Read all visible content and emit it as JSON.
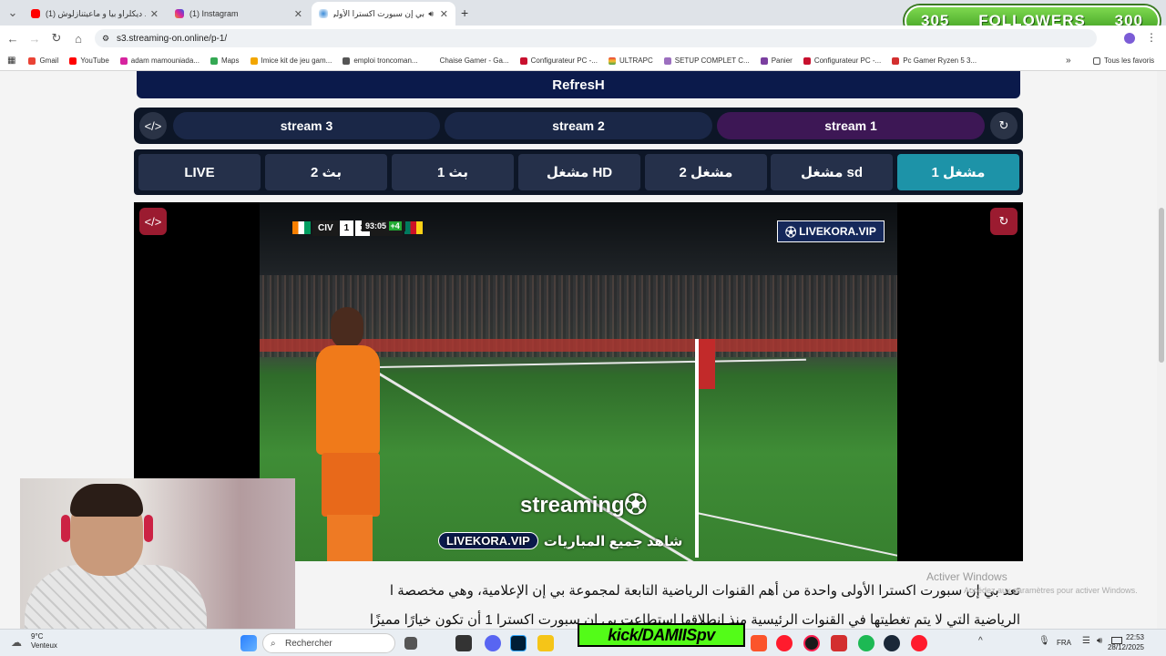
{
  "browser": {
    "tabs": [
      {
        "title": "(1) ديكلراو بيا و ماعيتنازلوش ... -",
        "active": false,
        "icon": "youtube-icon"
      },
      {
        "title": "(1) Instagram",
        "active": false,
        "icon": "instagram-icon"
      },
      {
        "title": "بي إن سبورت اكسترا الأولى",
        "active": true,
        "icon": "site-icon"
      }
    ],
    "url": "s3.streaming-on.online/p-1/",
    "bookmarks": [
      "Gmail",
      "YouTube",
      "adam mamouniada...",
      "Maps",
      "Imice kit de jeu gam...",
      "emploi troncoman...",
      "Chaise Gamer - Ga...",
      "Configurateur PC -...",
      "ULTRAPC",
      "SETUP COMPLET C...",
      "Panier",
      "Configurateur PC -...",
      "Pc Gamer Ryzen 5 3..."
    ],
    "all_bookmarks": "Tous les favoris",
    "colors": {
      "youtube": "#ff0000",
      "instagram": "#d6249f",
      "chrome_bar": "#dfe3e8"
    }
  },
  "overlay": {
    "followers_current": "305",
    "followers_label": "FOLLOWERS",
    "followers_goal": "300",
    "kick_channel": "kick/DAMIISpv"
  },
  "page": {
    "refresh_label": "RefresH",
    "streams": [
      "stream 3",
      "stream 2",
      "stream 1"
    ],
    "active_stream": "stream 1",
    "servers": [
      "LIVE",
      "بث 2",
      "بث 1",
      "مشغل HD",
      "مشغل 2",
      "مشغل sd",
      "مشغل 1"
    ],
    "active_server": "مشغل 1",
    "video": {
      "home_team": "CIV",
      "home_score": "1",
      "away_score": "1",
      "away_team": "CMR",
      "clock": "93:05",
      "added_time": "+4",
      "broadcaster_logo": "LIVEKORA.VIP",
      "watermark": "streaming",
      "caption_badge": "LIVEKORA.VIP",
      "caption_text": "شاهد جميع المباريات"
    },
    "article": [
      "تعد بي إن سبورت اكسترا الأولى واحدة من أهم القنوات الرياضية التابعة لمجموعة بي إن الإعلامية، وهي مخصصة ا",
      "الرياضية التي لا يتم تغطيتها في القنوات الرئيسية منذ انطلاقها استطاعت بي إن سبورت اكسترا 1 أن تكون خيارًا مميزًا"
    ],
    "windows_activation_title": "Activer Windows",
    "windows_activation_sub": "Accédez aux paramètres pour activer Windows."
  },
  "taskbar": {
    "temperature": "9°C",
    "weather": "Venteux",
    "search_placeholder": "Rechercher",
    "language": "FRA",
    "time": "22:53",
    "date": "28/12/2025"
  }
}
